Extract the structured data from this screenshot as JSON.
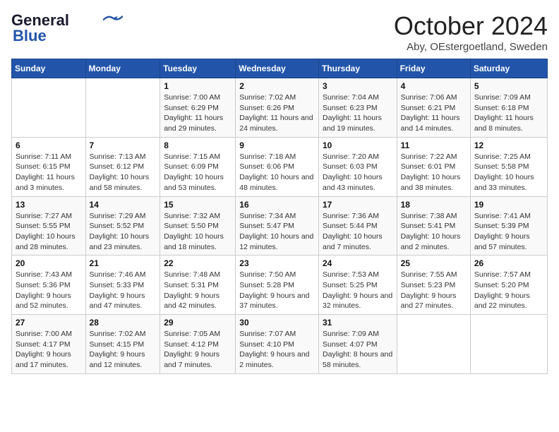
{
  "logo": {
    "line1": "General",
    "line2": "Blue"
  },
  "title": "October 2024",
  "subtitle": "Aby, OEstergoetland, Sweden",
  "days_of_week": [
    "Sunday",
    "Monday",
    "Tuesday",
    "Wednesday",
    "Thursday",
    "Friday",
    "Saturday"
  ],
  "weeks": [
    [
      {
        "day": "",
        "info": ""
      },
      {
        "day": "",
        "info": ""
      },
      {
        "day": "1",
        "info": "Sunrise: 7:00 AM\nSunset: 6:29 PM\nDaylight: 11 hours and 29 minutes."
      },
      {
        "day": "2",
        "info": "Sunrise: 7:02 AM\nSunset: 6:26 PM\nDaylight: 11 hours and 24 minutes."
      },
      {
        "day": "3",
        "info": "Sunrise: 7:04 AM\nSunset: 6:23 PM\nDaylight: 11 hours and 19 minutes."
      },
      {
        "day": "4",
        "info": "Sunrise: 7:06 AM\nSunset: 6:21 PM\nDaylight: 11 hours and 14 minutes."
      },
      {
        "day": "5",
        "info": "Sunrise: 7:09 AM\nSunset: 6:18 PM\nDaylight: 11 hours and 8 minutes."
      }
    ],
    [
      {
        "day": "6",
        "info": "Sunrise: 7:11 AM\nSunset: 6:15 PM\nDaylight: 11 hours and 3 minutes."
      },
      {
        "day": "7",
        "info": "Sunrise: 7:13 AM\nSunset: 6:12 PM\nDaylight: 10 hours and 58 minutes."
      },
      {
        "day": "8",
        "info": "Sunrise: 7:15 AM\nSunset: 6:09 PM\nDaylight: 10 hours and 53 minutes."
      },
      {
        "day": "9",
        "info": "Sunrise: 7:18 AM\nSunset: 6:06 PM\nDaylight: 10 hours and 48 minutes."
      },
      {
        "day": "10",
        "info": "Sunrise: 7:20 AM\nSunset: 6:03 PM\nDaylight: 10 hours and 43 minutes."
      },
      {
        "day": "11",
        "info": "Sunrise: 7:22 AM\nSunset: 6:01 PM\nDaylight: 10 hours and 38 minutes."
      },
      {
        "day": "12",
        "info": "Sunrise: 7:25 AM\nSunset: 5:58 PM\nDaylight: 10 hours and 33 minutes."
      }
    ],
    [
      {
        "day": "13",
        "info": "Sunrise: 7:27 AM\nSunset: 5:55 PM\nDaylight: 10 hours and 28 minutes."
      },
      {
        "day": "14",
        "info": "Sunrise: 7:29 AM\nSunset: 5:52 PM\nDaylight: 10 hours and 23 minutes."
      },
      {
        "day": "15",
        "info": "Sunrise: 7:32 AM\nSunset: 5:50 PM\nDaylight: 10 hours and 18 minutes."
      },
      {
        "day": "16",
        "info": "Sunrise: 7:34 AM\nSunset: 5:47 PM\nDaylight: 10 hours and 12 minutes."
      },
      {
        "day": "17",
        "info": "Sunrise: 7:36 AM\nSunset: 5:44 PM\nDaylight: 10 hours and 7 minutes."
      },
      {
        "day": "18",
        "info": "Sunrise: 7:38 AM\nSunset: 5:41 PM\nDaylight: 10 hours and 2 minutes."
      },
      {
        "day": "19",
        "info": "Sunrise: 7:41 AM\nSunset: 5:39 PM\nDaylight: 9 hours and 57 minutes."
      }
    ],
    [
      {
        "day": "20",
        "info": "Sunrise: 7:43 AM\nSunset: 5:36 PM\nDaylight: 9 hours and 52 minutes."
      },
      {
        "day": "21",
        "info": "Sunrise: 7:46 AM\nSunset: 5:33 PM\nDaylight: 9 hours and 47 minutes."
      },
      {
        "day": "22",
        "info": "Sunrise: 7:48 AM\nSunset: 5:31 PM\nDaylight: 9 hours and 42 minutes."
      },
      {
        "day": "23",
        "info": "Sunrise: 7:50 AM\nSunset: 5:28 PM\nDaylight: 9 hours and 37 minutes."
      },
      {
        "day": "24",
        "info": "Sunrise: 7:53 AM\nSunset: 5:25 PM\nDaylight: 9 hours and 32 minutes."
      },
      {
        "day": "25",
        "info": "Sunrise: 7:55 AM\nSunset: 5:23 PM\nDaylight: 9 hours and 27 minutes."
      },
      {
        "day": "26",
        "info": "Sunrise: 7:57 AM\nSunset: 5:20 PM\nDaylight: 9 hours and 22 minutes."
      }
    ],
    [
      {
        "day": "27",
        "info": "Sunrise: 7:00 AM\nSunset: 4:17 PM\nDaylight: 9 hours and 17 minutes."
      },
      {
        "day": "28",
        "info": "Sunrise: 7:02 AM\nSunset: 4:15 PM\nDaylight: 9 hours and 12 minutes."
      },
      {
        "day": "29",
        "info": "Sunrise: 7:05 AM\nSunset: 4:12 PM\nDaylight: 9 hours and 7 minutes."
      },
      {
        "day": "30",
        "info": "Sunrise: 7:07 AM\nSunset: 4:10 PM\nDaylight: 9 hours and 2 minutes."
      },
      {
        "day": "31",
        "info": "Sunrise: 7:09 AM\nSunset: 4:07 PM\nDaylight: 8 hours and 58 minutes."
      },
      {
        "day": "",
        "info": ""
      },
      {
        "day": "",
        "info": ""
      }
    ]
  ]
}
